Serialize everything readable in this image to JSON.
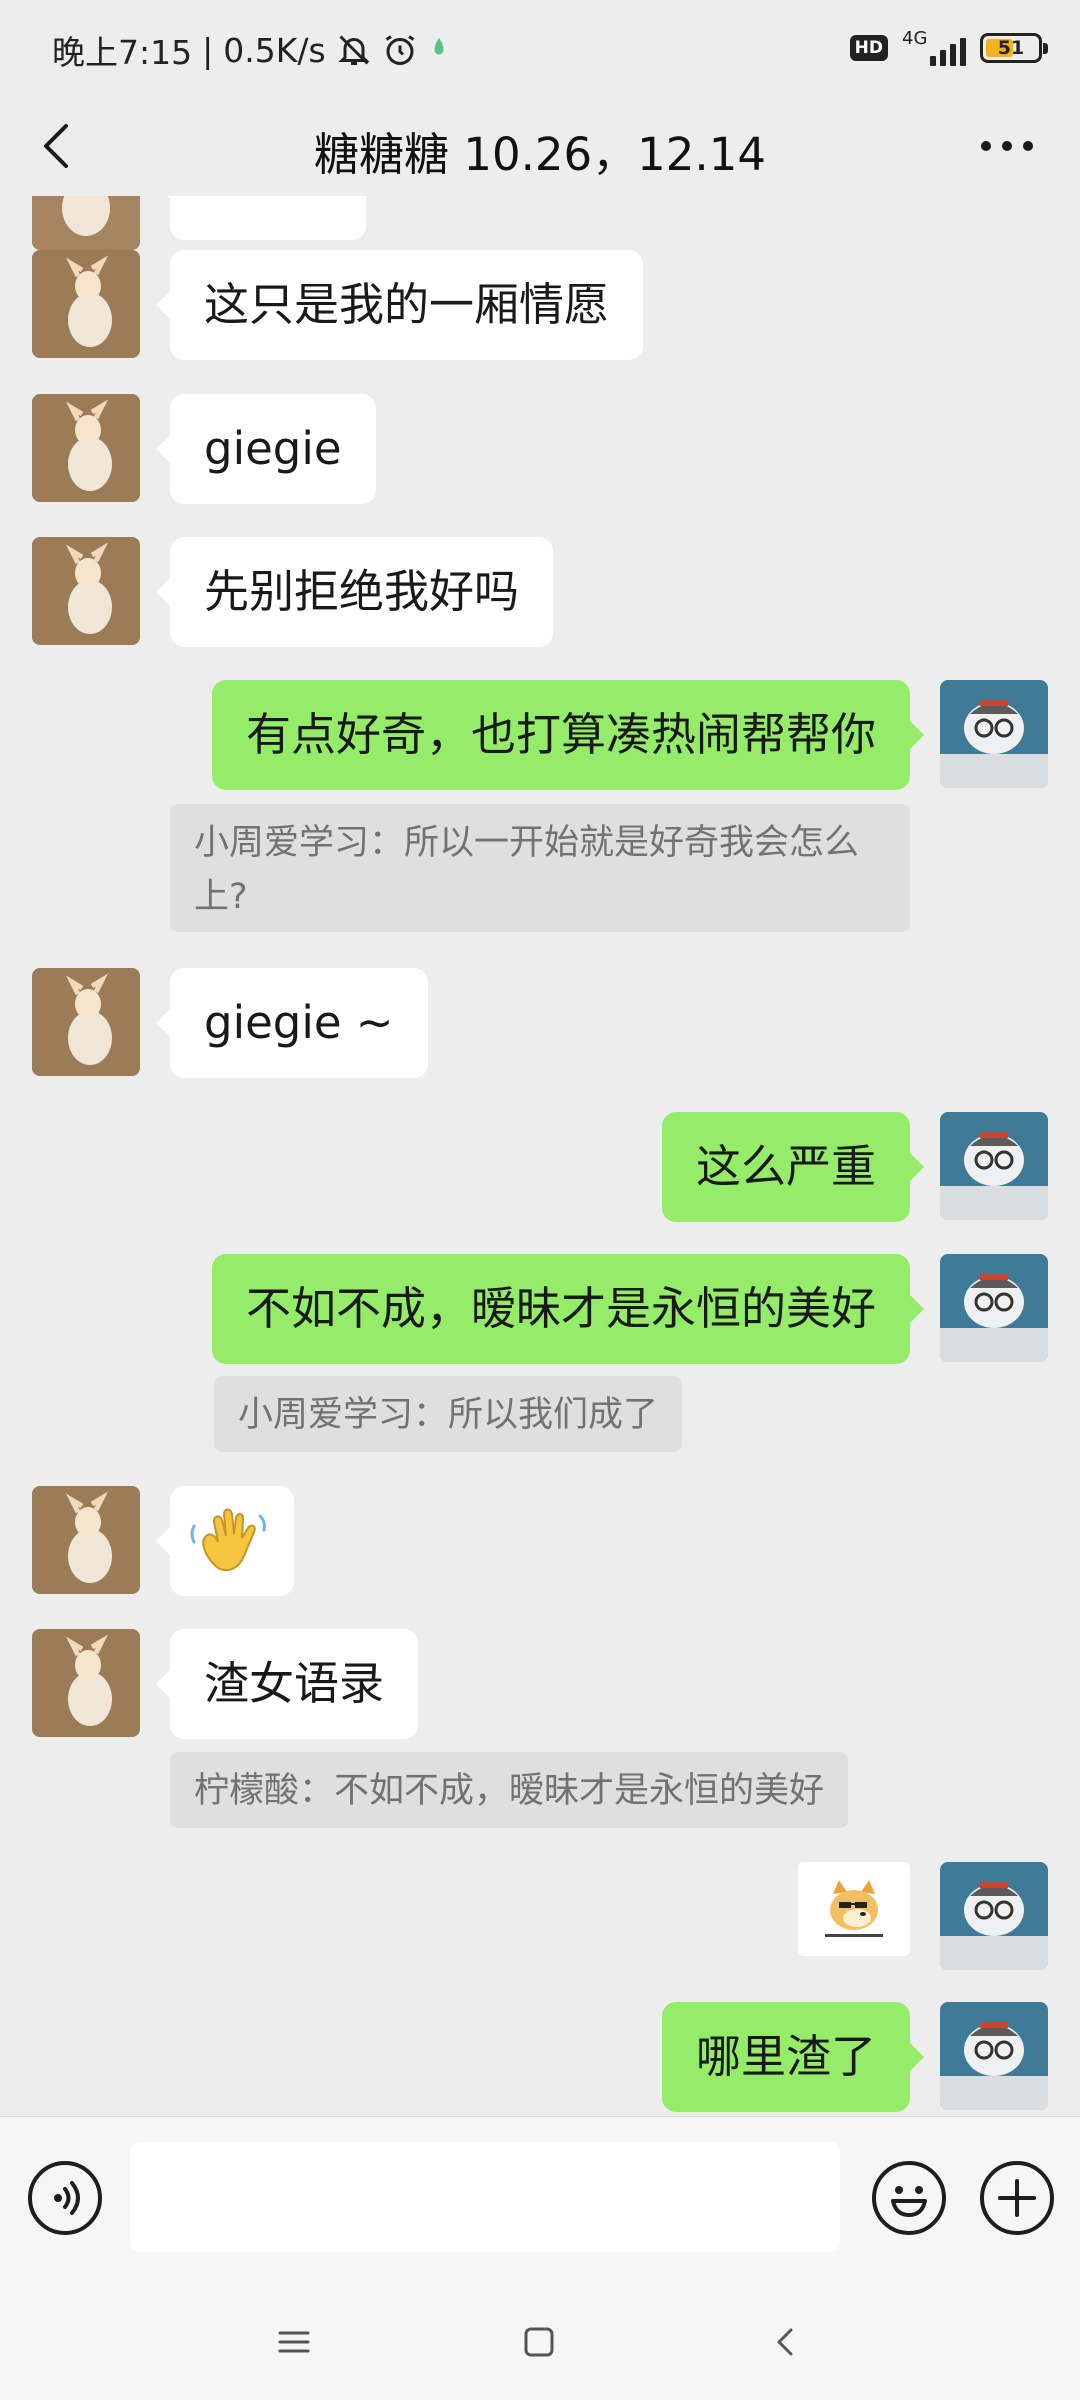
{
  "status_bar": {
    "time": "晚上7:15",
    "speed": "0.5K/s",
    "hd": "HD",
    "network": "4G",
    "battery": "51",
    "battery_level": 0.51
  },
  "header": {
    "title": "糖糖糖 10.26，12.14"
  },
  "messages": [
    {
      "side": "left",
      "text": "这只是我的一厢情愿"
    },
    {
      "side": "left",
      "text": "giegie"
    },
    {
      "side": "left",
      "text": "先别拒绝我好吗"
    },
    {
      "side": "right",
      "text": "有点好奇，也打算凑热闹帮帮你"
    },
    {
      "side": "quote",
      "text": "小周爱学习：所以一开始就是好奇我会怎么上?"
    },
    {
      "side": "left",
      "text": "giegie ~"
    },
    {
      "side": "right",
      "text": "这么严重"
    },
    {
      "side": "right",
      "text": "不如不成，暧昧才是永恒的美好"
    },
    {
      "side": "quote",
      "text": "小周爱学习：所以我们成了"
    },
    {
      "side": "left",
      "type": "emoji",
      "icon": "waving-hand-emoji"
    },
    {
      "side": "left",
      "text": "渣女语录"
    },
    {
      "side": "quote",
      "text": "柠檬酸：不如不成，暧昧才是永恒的美好"
    },
    {
      "side": "right",
      "type": "sticker",
      "icon": "doge-sticker"
    },
    {
      "side": "right",
      "text": "哪里渣了"
    }
  ],
  "input": {
    "placeholder": ""
  },
  "colors": {
    "background": "#ededed",
    "my_bubble": "#95ec69",
    "their_bubble": "#ffffff",
    "quote": "#dfdfdf"
  }
}
